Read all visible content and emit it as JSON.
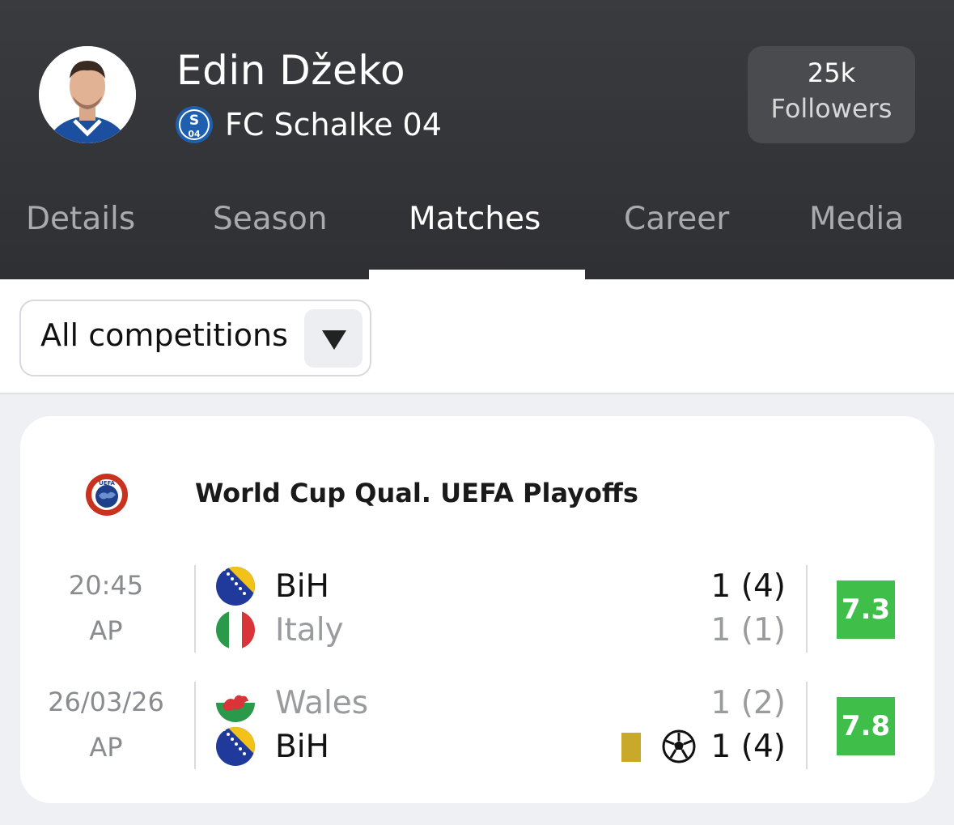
{
  "player": {
    "name": "Edin Džeko",
    "club": "FC Schalke 04",
    "followers_count": "25k",
    "followers_label": "Followers"
  },
  "tabs": [
    {
      "label": "Details",
      "active": false
    },
    {
      "label": "Season",
      "active": false
    },
    {
      "label": "Matches",
      "active": true
    },
    {
      "label": "Career",
      "active": false
    },
    {
      "label": "Media",
      "active": false
    }
  ],
  "filter": {
    "selected": "All competitions"
  },
  "competition": {
    "name": "World Cup Qual. UEFA Playoffs",
    "icon": "uefa-logo"
  },
  "matches": [
    {
      "time": "20:45",
      "status": "AP",
      "home": {
        "name": "BiH",
        "score": "1 (4)",
        "flag": "bosnia-flag"
      },
      "away": {
        "name": "Italy",
        "score": "1 (1)",
        "flag": "italy-flag"
      },
      "rating": "7.3",
      "rating_color": "#3fbf4a"
    },
    {
      "time": "26/03/26",
      "status": "AP",
      "home": {
        "name": "Wales",
        "score": "1 (2)",
        "flag": "wales-flag"
      },
      "away": {
        "name": "BiH",
        "score": "1 (4)",
        "flag": "bosnia-flag"
      },
      "rating": "7.8",
      "rating_color": "#3fbf4a",
      "events": [
        "yellow-card-icon",
        "goal-ball-icon"
      ]
    }
  ],
  "colors": {
    "header_bg": "#333438",
    "rating_green": "#3fbf4a",
    "yellow_card": "#c9a92a"
  }
}
